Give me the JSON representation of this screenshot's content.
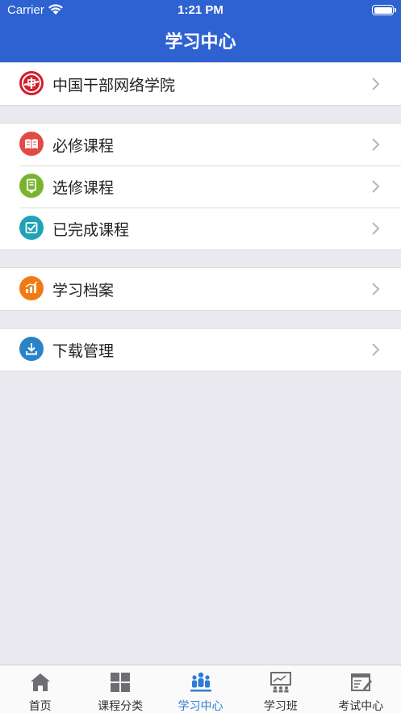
{
  "status_bar": {
    "carrier": "Carrier",
    "time": "1:21 PM"
  },
  "nav": {
    "title": "学习中心"
  },
  "groups": [
    {
      "items": [
        {
          "label": "中国干部网络学院",
          "icon": "academy-logo-icon",
          "color": "#d21f2b"
        }
      ]
    },
    {
      "items": [
        {
          "label": "必修课程",
          "icon": "book-icon",
          "color": "#e24b45"
        },
        {
          "label": "选修课程",
          "icon": "elective-icon",
          "color": "#7ab32e"
        },
        {
          "label": "已完成课程",
          "icon": "checkbox-icon",
          "color": "#1fa3b5"
        }
      ]
    },
    {
      "items": [
        {
          "label": "学习档案",
          "icon": "chart-icon",
          "color": "#f07a16"
        }
      ]
    },
    {
      "items": [
        {
          "label": "下载管理",
          "icon": "download-icon",
          "color": "#2b83c6"
        }
      ]
    }
  ],
  "tabbar": {
    "tabs": [
      {
        "label": "首页",
        "icon": "home-icon"
      },
      {
        "label": "课程分类",
        "icon": "grid-icon"
      },
      {
        "label": "学习中心",
        "icon": "people-icon",
        "active": true
      },
      {
        "label": "学习班",
        "icon": "presentation-icon"
      },
      {
        "label": "考试中心",
        "icon": "exam-icon"
      }
    ],
    "active_color": "#2f7bd6",
    "inactive_color": "#333333"
  },
  "colors": {
    "nav_bg": "#2f62d1",
    "page_bg": "#e9e9ef"
  }
}
